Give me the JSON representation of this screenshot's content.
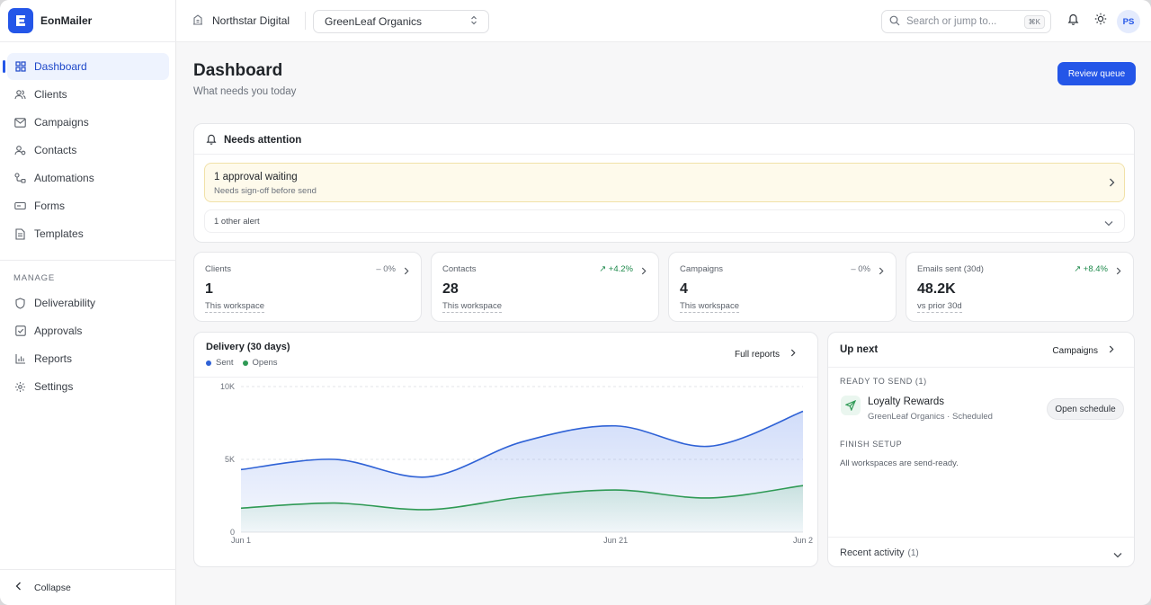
{
  "brand": {
    "letter": "E",
    "name": "EonMailer"
  },
  "sidebar": {
    "items": [
      {
        "label": "Dashboard",
        "icon": "grid-icon",
        "active": true
      },
      {
        "label": "Clients",
        "icon": "users-icon"
      },
      {
        "label": "Campaigns",
        "icon": "mail-icon"
      },
      {
        "label": "Contacts",
        "icon": "contacts-icon"
      },
      {
        "label": "Automations",
        "icon": "workflow-icon"
      },
      {
        "label": "Forms",
        "icon": "form-icon"
      },
      {
        "label": "Templates",
        "icon": "file-icon"
      }
    ],
    "manage_label": "MANAGE",
    "manage_items": [
      {
        "label": "Deliverability",
        "icon": "shield-icon"
      },
      {
        "label": "Approvals",
        "icon": "check-square-icon"
      },
      {
        "label": "Reports",
        "icon": "bar-chart-icon"
      },
      {
        "label": "Settings",
        "icon": "gear-icon"
      }
    ],
    "collapse_label": "Collapse"
  },
  "topbar": {
    "org": "Northstar Digital",
    "client": "GreenLeaf Organics",
    "search_placeholder": "Search or jump to...",
    "search_shortcut": "⌘K",
    "avatar": "PS"
  },
  "page": {
    "title": "Dashboard",
    "subtitle": "What needs you today",
    "primary_action": "Review queue"
  },
  "attention": {
    "title": "Needs attention",
    "alert_title": "1 approval waiting",
    "alert_sub": "Needs sign-off before send",
    "other": "1 other alert"
  },
  "stats": [
    {
      "label": "Clients",
      "delta": "– 0%",
      "trend": "flat",
      "value": "1",
      "note": "This workspace"
    },
    {
      "label": "Contacts",
      "delta": "↗ +4.2%",
      "trend": "up",
      "value": "28",
      "note": "This workspace"
    },
    {
      "label": "Campaigns",
      "delta": "– 0%",
      "trend": "flat",
      "value": "4",
      "note": "This workspace"
    },
    {
      "label": "Emails sent (30d)",
      "delta": "↗ +8.4%",
      "trend": "up",
      "value": "48.2K",
      "note": "vs prior 30d"
    }
  ],
  "delivery": {
    "title": "Delivery (30 days)",
    "link": "Full reports"
  },
  "chart_data": {
    "type": "area",
    "title": "Delivery (30 days)",
    "x_ticks": [
      "Jun 1",
      "Jun 21",
      "Jun 2"
    ],
    "y_ticks": [
      "0",
      "5K",
      "10K"
    ],
    "ylim": [
      0,
      10000
    ],
    "grid": true,
    "legend": "top-left",
    "x": [
      1,
      6,
      11,
      16,
      21,
      26,
      31
    ],
    "series": [
      {
        "name": "Sent",
        "color": "#2f62d6",
        "values": [
          4300,
          5000,
          3800,
          6200,
          7300,
          5900,
          8300
        ]
      },
      {
        "name": "Opens",
        "color": "#2f9a55",
        "values": [
          1650,
          2000,
          1550,
          2400,
          2900,
          2350,
          3200
        ]
      }
    ]
  },
  "upnext": {
    "title": "Up next",
    "link": "Campaigns",
    "ready_label": "READY TO SEND (1)",
    "item_title": "Loyalty Rewards",
    "item_sub": "GreenLeaf Organics · Scheduled",
    "item_action": "Open schedule",
    "setup_label": "FINISH SETUP",
    "setup_text": "All workspaces are send-ready.",
    "recent_label": "Recent activity",
    "recent_count": "(1)"
  },
  "colors": {
    "accent": "#2456e8",
    "up": "#1f8a4c",
    "warn_bg": "#fefaeb"
  }
}
